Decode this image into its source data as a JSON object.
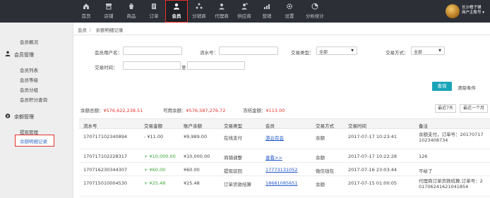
{
  "nav": {
    "items": [
      {
        "label": "首页",
        "icon": "home-icon"
      },
      {
        "label": "店铺",
        "icon": "store-icon"
      },
      {
        "label": "商品",
        "icon": "goods-icon"
      },
      {
        "label": "订单",
        "icon": "order-icon"
      },
      {
        "label": "会员",
        "icon": "member-icon",
        "active": true
      },
      {
        "label": "分销商",
        "icon": "distributor-icon"
      },
      {
        "label": "代理商",
        "icon": "agent-icon"
      },
      {
        "label": "供应商",
        "icon": "supplier-icon"
      },
      {
        "label": "营销",
        "icon": "marketing-icon"
      },
      {
        "label": "设置",
        "icon": "settings-icon"
      },
      {
        "label": "分析统计",
        "icon": "analytics-icon"
      }
    ],
    "user": {
      "line1": "长沙橙子铺",
      "line2": "商户主账号 ▾"
    }
  },
  "sidebar": {
    "overview": "会员概况",
    "group1": {
      "title": "会员管理",
      "links": [
        "会员列表",
        "会员等级",
        "会员分组",
        "会员积分查询"
      ]
    },
    "group2": {
      "title": "余额管理",
      "links": [
        "提现管理",
        "余额明细记录"
      ]
    }
  },
  "breadcrumb": {
    "root": "会员",
    "sep": "〉",
    "current": "余额明细记录"
  },
  "filters": {
    "member_account_label": "会员用户名：",
    "serial_no_label": "流水号：",
    "trade_type_label": "交易类型：",
    "trade_type_value": "全部",
    "trade_method_label": "交易方式：",
    "trade_method_value": "全部",
    "trade_time_label": "交易时间：",
    "date_sep": "至",
    "query_button": "查询",
    "clear_button": "清除条件"
  },
  "summary": {
    "total_label": "余额总额：",
    "total_value": "¥576,622,238.51",
    "available_label": "可用余额：",
    "available_value": "¥576,587,276.72",
    "frozen_label": "冻结金额：",
    "frozen_value": "¥113.00",
    "btn_7days": "最近7天",
    "btn_month": "最近一个月"
  },
  "table": {
    "headers": [
      "流水号",
      "交易金额",
      "账户余额",
      "交易类型",
      "会员",
      "交易方式",
      "交易时间",
      "备注"
    ],
    "rows": [
      {
        "serial": "170717102340894",
        "amount": "- ¥11.00",
        "balance": "¥9,989.00",
        "type": "在线支付",
        "member": "游云有会",
        "method": "余额",
        "time": "2017-07-17 10:23:41",
        "note": "余额支付，订单号：201707171023408734"
      },
      {
        "serial": "170717102228317",
        "amount": "+ ¥10,000.00",
        "balance": "¥10,000.00",
        "type": "商铺调整",
        "member": "查看>>",
        "method": "余额",
        "time": "2017-07-17 10:22:28",
        "note": "126"
      },
      {
        "serial": "170716230344307",
        "amount": "+ ¥60.00",
        "balance": "¥60.00",
        "type": "提现驳回",
        "member": "17773131052",
        "method": "微信钱包",
        "time": "2017-07-16 23:03:44",
        "note": "不给了"
      },
      {
        "serial": "170715010004530",
        "amount": "+ ¥25.48",
        "balance": "¥25.48",
        "type": "订单货款结算",
        "member": "18681085651",
        "method": "余额",
        "time": "2017-07-15 01:00:05",
        "note": "代理商订单货款结算,订单号：201706241621041854"
      }
    ]
  },
  "colors": {
    "accent": "#1aa4b8",
    "highlight": "#e5322d",
    "topbar": "#2c2f36",
    "link": "#2157c9",
    "positive": "#3aa53a"
  }
}
